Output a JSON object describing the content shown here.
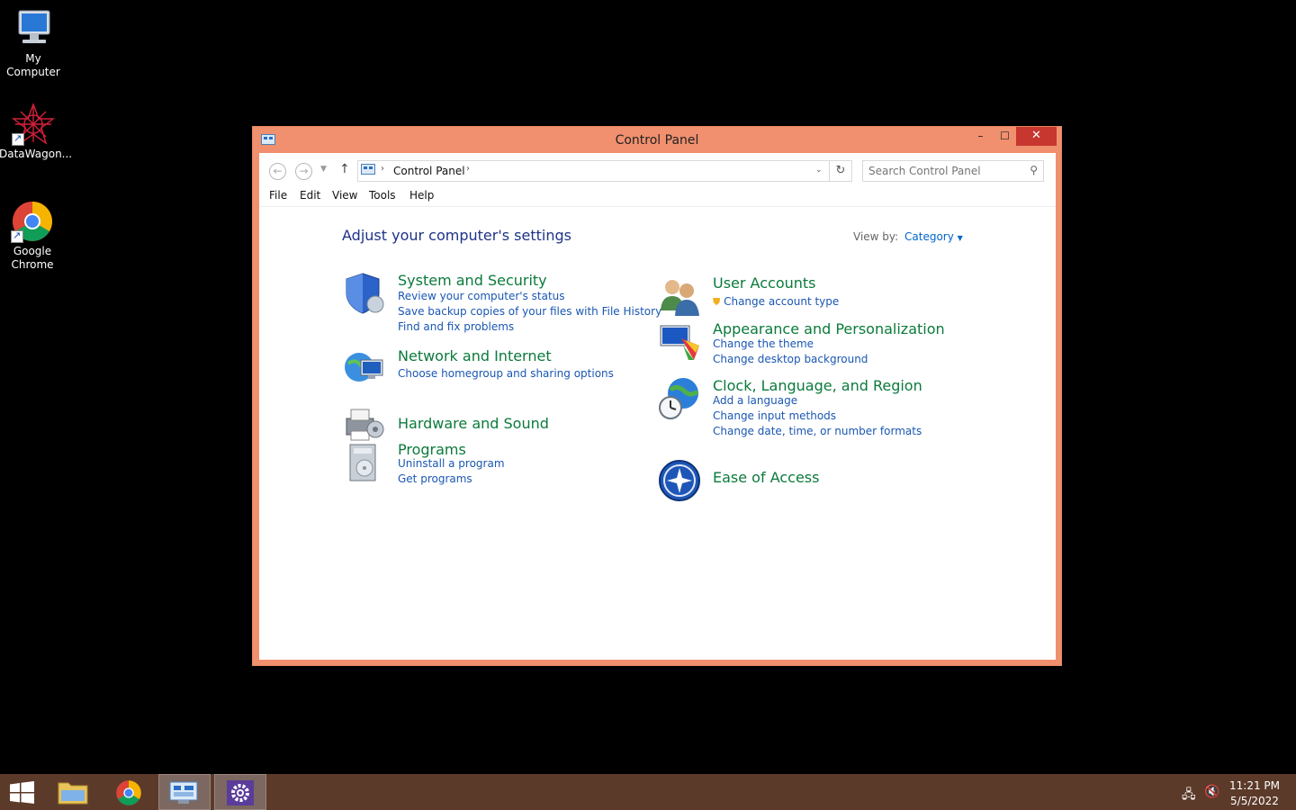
{
  "desktop": {
    "icons": [
      {
        "label": "My Computer"
      },
      {
        "label": "DataWagon..."
      },
      {
        "label": "Google Chrome"
      }
    ]
  },
  "window": {
    "title": "Control Panel",
    "minimize": "–",
    "maximize": "☐",
    "close": "✕",
    "address": {
      "crumb": "Control Panel"
    },
    "search_placeholder": "Search Control Panel",
    "menu": [
      "File",
      "Edit",
      "View",
      "Tools",
      "Help"
    ]
  },
  "content": {
    "heading": "Adjust your computer's settings",
    "view_by_label": "View by:",
    "view_by_value": "Category",
    "categories": [
      {
        "title": "System and Security",
        "links": [
          "Review your computer's status",
          "Save backup copies of your files with File History",
          "Find and fix problems"
        ]
      },
      {
        "title": "Network and Internet",
        "links": [
          "Choose homegroup and sharing options"
        ]
      },
      {
        "title": "Hardware and Sound",
        "links": []
      },
      {
        "title": "Programs",
        "links": [
          "Uninstall a program",
          "Get programs"
        ]
      },
      {
        "title": "User Accounts",
        "links": [
          "Change account type"
        ]
      },
      {
        "title": "Appearance and Personalization",
        "links": [
          "Change the theme",
          "Change desktop background"
        ]
      },
      {
        "title": "Clock, Language, and Region",
        "links": [
          "Add a language",
          "Change input methods",
          "Change date, time, or number formats"
        ]
      },
      {
        "title": "Ease of Access",
        "links": []
      }
    ]
  },
  "taskbar": {
    "time": "11:21 PM",
    "date": "5/5/2022"
  },
  "colors": {
    "titlebar": "#f0906e",
    "close": "#c7372f",
    "category_title": "#0b7a3b",
    "link": "#1a57b3",
    "heading": "#1e3287",
    "taskbar": "#5c3a2a"
  }
}
